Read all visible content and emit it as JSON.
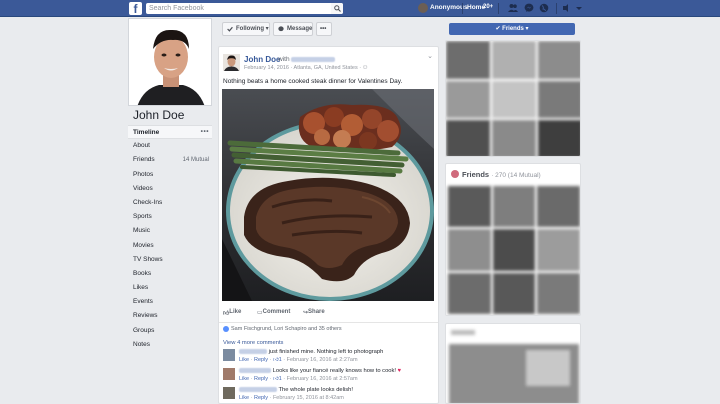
{
  "topbar": {
    "logo": "f",
    "search_placeholder": "Search Facebook",
    "user_name": "Anonymous",
    "home_label": "Home",
    "notif_count": "20+"
  },
  "profile": {
    "name": "John Doe"
  },
  "nav": [
    {
      "label": "Timeline",
      "extra": "•••"
    },
    {
      "label": "About",
      "extra": ""
    },
    {
      "label": "Friends",
      "extra": "14 Mutual"
    },
    {
      "label": "Photos",
      "extra": ""
    },
    {
      "label": "Videos",
      "extra": ""
    },
    {
      "label": "Check-Ins",
      "extra": ""
    },
    {
      "label": "Sports",
      "extra": ""
    },
    {
      "label": "Music",
      "extra": ""
    },
    {
      "label": "Movies",
      "extra": ""
    },
    {
      "label": "TV Shows",
      "extra": ""
    },
    {
      "label": "Books",
      "extra": ""
    },
    {
      "label": "Likes",
      "extra": ""
    },
    {
      "label": "Events",
      "extra": ""
    },
    {
      "label": "Reviews",
      "extra": ""
    },
    {
      "label": "Groups",
      "extra": ""
    },
    {
      "label": "Notes",
      "extra": ""
    }
  ],
  "actions": {
    "following": "Following ▾",
    "message": "Message",
    "more": "•••"
  },
  "post": {
    "author": "John Doe",
    "with_label": "with",
    "date_location": "February 14, 2016 · Atlanta, GA, United States ·",
    "text": "Nothing beats a home cooked steak dinner for Valentines Day.",
    "like": "Like",
    "comment": "Comment",
    "share": "Share",
    "likes_summary": "Sam Fischgrund, Lori Schapiro and 35 others",
    "view_more": "View 4 more comments"
  },
  "comments": [
    {
      "text": "just finished mine. Nothing left to photograph",
      "meta": "February 16, 2016 at 2:27am",
      "reactions": "1"
    },
    {
      "text": "Looks like your fiancé really knows how to cook!",
      "meta": "February 16, 2016 at 2:57am",
      "reactions": "1"
    },
    {
      "text": "The whole plate looks delish!",
      "meta": "February 15, 2016 at 8:42am",
      "reactions": ""
    }
  ],
  "comment_links": {
    "like": "Like",
    "reply": "Reply"
  },
  "right": {
    "friends_button": "✔ Friends ▾",
    "friends_title": "Friends",
    "friends_sub": "· 270 (14 Mutual)"
  },
  "colors": {
    "brand": "#3b5998",
    "link": "#365899",
    "button_blue": "#4267b2",
    "background": "#e9ebee"
  }
}
